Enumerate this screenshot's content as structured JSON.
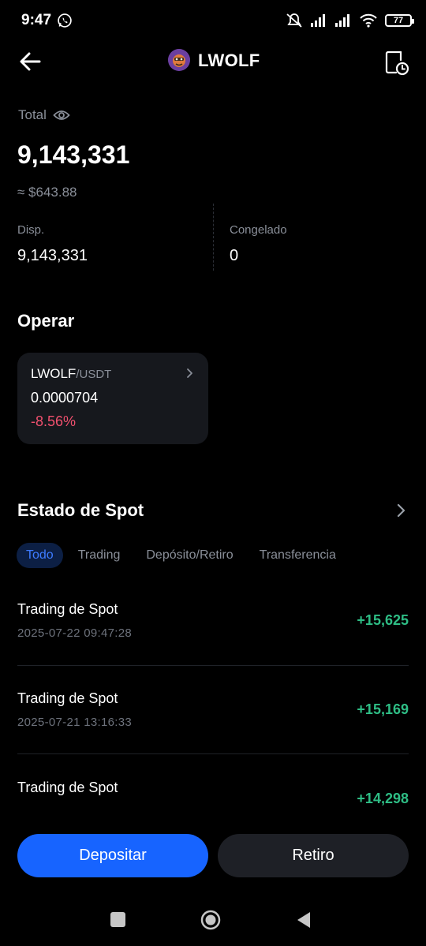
{
  "status_bar": {
    "time": "9:47",
    "battery": "77",
    "icons": [
      "whatsapp-icon",
      "mute-icon",
      "signal-icon",
      "signal-icon",
      "wifi-icon",
      "battery-icon"
    ]
  },
  "header": {
    "title": "LWOLF",
    "back_icon": "back-arrow-icon",
    "history_icon": "document-history-icon"
  },
  "balance": {
    "total_label": "Total",
    "total_value": "9,143,331",
    "usd_value": "≈ $643.88",
    "available_label": "Disp.",
    "available_value": "9,143,331",
    "frozen_label": "Congelado",
    "frozen_value": "0"
  },
  "trade": {
    "title": "Operar",
    "card": {
      "base": "LWOLF",
      "quote": "/USDT",
      "price": "0.0000704",
      "change": "-8.56%"
    }
  },
  "spot_status": {
    "title": "Estado de Spot",
    "tabs": [
      {
        "label": "Todo",
        "active": true
      },
      {
        "label": "Trading",
        "active": false
      },
      {
        "label": "Depósito/Retiro",
        "active": false
      },
      {
        "label": "Transferencia",
        "active": false
      }
    ],
    "transactions": [
      {
        "title": "Trading de Spot",
        "time": "2025-07-22 09:47:28",
        "amount": "+15,625"
      },
      {
        "title": "Trading de Spot",
        "time": "2025-07-21 13:16:33",
        "amount": "+15,169"
      },
      {
        "title": "Trading de Spot",
        "time": "",
        "amount": "+14,298"
      }
    ]
  },
  "actions": {
    "deposit": "Depositar",
    "withdraw": "Retiro"
  },
  "colors": {
    "accent": "#1764ff",
    "positive": "#2ebd85",
    "negative": "#f0506e",
    "background": "#000000"
  }
}
